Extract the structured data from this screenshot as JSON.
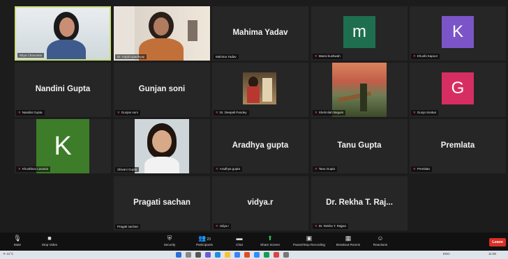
{
  "participants": [
    {
      "label": "Nitya Chaurasia",
      "display_name": "",
      "kind": "video",
      "active": true,
      "muted": false
    },
    {
      "label": "Dr. Anjali Upadhyay",
      "display_name": "",
      "kind": "video",
      "active": false,
      "muted": false
    },
    {
      "label": "Mahima Yadav",
      "display_name": "Mahima Yadav",
      "kind": "name",
      "active": false,
      "muted": false
    },
    {
      "label": "Mansi kushwah",
      "display_name": "",
      "kind": "avatar",
      "avatar_letter": "m",
      "avatar_color": "#1e6e50",
      "active": false,
      "muted": true
    },
    {
      "label": "Khushi Kapoor",
      "display_name": "",
      "kind": "avatar",
      "avatar_letter": "K",
      "avatar_color": "#7b55c8",
      "active": false,
      "muted": true
    },
    {
      "label": "Nandini Gupta",
      "display_name": "Nandini Gupta",
      "kind": "name",
      "active": false,
      "muted": true
    },
    {
      "label": "Gunjan soni",
      "display_name": "Gunjan soni",
      "kind": "name",
      "active": false,
      "muted": true
    },
    {
      "label": "Dr. Deepali Pandey",
      "display_name": "",
      "kind": "image",
      "active": false,
      "muted": true
    },
    {
      "label": "Shehnilah Begum",
      "display_name": "",
      "kind": "image",
      "active": false,
      "muted": true
    },
    {
      "label": "Gunja Sonkar",
      "display_name": "",
      "kind": "avatar",
      "avatar_letter": "G",
      "avatar_color": "#d62e63",
      "active": false,
      "muted": true
    },
    {
      "label": "Khushboo Lavania",
      "display_name": "",
      "kind": "avatar",
      "avatar_letter": "K",
      "avatar_color": "#3d7d29",
      "active": false,
      "muted": true
    },
    {
      "label": "Shivani Gupta",
      "display_name": "",
      "kind": "image",
      "active": false,
      "muted": false
    },
    {
      "label": "Aradhya gupta",
      "display_name": "Aradhya gupta",
      "kind": "name",
      "active": false,
      "muted": true
    },
    {
      "label": "Tanu Gupta",
      "display_name": "Tanu Gupta",
      "kind": "name",
      "active": false,
      "muted": true
    },
    {
      "label": "Premlata",
      "display_name": "Premlata",
      "kind": "name",
      "active": false,
      "muted": true
    },
    {
      "label": "Pragati sachan",
      "display_name": "Pragati sachan",
      "kind": "name",
      "active": false,
      "muted": false
    },
    {
      "label": "vidya.r",
      "display_name": "vidya.r",
      "kind": "name",
      "active": false,
      "muted": true
    },
    {
      "label": "Dr. Rekha T. Rajput",
      "display_name": "Dr. Rekha T. Raj...",
      "kind": "name",
      "active": false,
      "muted": true
    }
  ],
  "toolbar": {
    "items": [
      {
        "name": "mute",
        "label": "Mute",
        "icon": "microphone-icon"
      },
      {
        "name": "stop-video",
        "label": "Stop Video",
        "icon": "video-camera-icon"
      },
      {
        "name": "security",
        "label": "Security",
        "icon": "shield-icon"
      },
      {
        "name": "participants",
        "label": "Participants",
        "icon": "participants-icon",
        "count": "23"
      },
      {
        "name": "chat",
        "label": "Chat",
        "icon": "chat-icon"
      },
      {
        "name": "share-screen",
        "label": "Share Screen",
        "icon": "share-screen-icon",
        "accent": "#2fc35a"
      },
      {
        "name": "recording",
        "label": "Pause/Stop Recording",
        "icon": "recording-icon"
      },
      {
        "name": "breakout-rooms",
        "label": "Breakout Rooms",
        "icon": "breakout-rooms-icon"
      },
      {
        "name": "reactions",
        "label": "Reactions",
        "icon": "reactions-icon"
      }
    ],
    "leave_label": "Leave",
    "leave_color": "#d93025"
  },
  "taskbar": {
    "weather": "41°C",
    "lang": "ENG",
    "time": "11:08"
  },
  "colors": {
    "background": "#1c1c1c",
    "tile": "#262626",
    "active_border": "#c9e07a",
    "muted_icon": "#e5484d"
  }
}
